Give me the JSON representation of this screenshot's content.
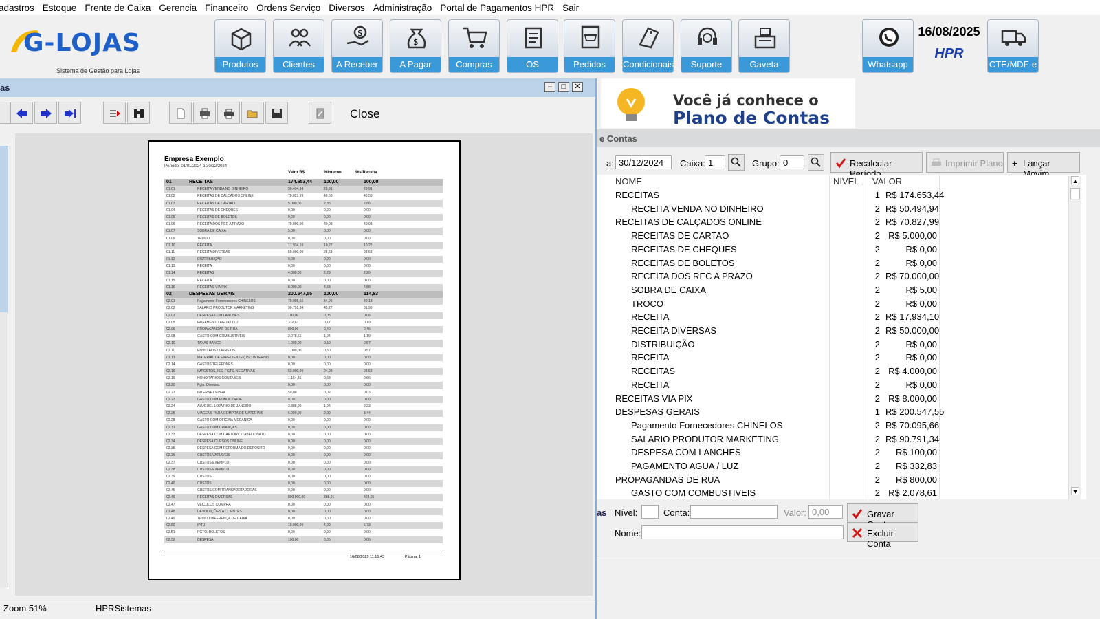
{
  "menu": [
    "adastros",
    "Estoque",
    "Frente de Caixa",
    "Gerencia",
    "Financeiro",
    "Ordens Serviço",
    "Diversos",
    "Administração",
    "Portal de Pagamentos HPR",
    "Sair"
  ],
  "logo": {
    "text": "G-LOJAS",
    "subtitle": "Sistema de Gestão para Lojas"
  },
  "toolbar": [
    {
      "label": "Produtos",
      "icon": "box-icon"
    },
    {
      "label": "Clientes",
      "icon": "people-icon"
    },
    {
      "label": "A Receber",
      "icon": "hand-money-icon"
    },
    {
      "label": "A Pagar",
      "icon": "money-bag-icon"
    },
    {
      "label": "Compras",
      "icon": "cart-icon"
    },
    {
      "label": "OS",
      "icon": "clipboard-icon"
    },
    {
      "label": "Pedidos",
      "icon": "order-cart-icon"
    },
    {
      "label": "Condicionais",
      "icon": "tag-icon"
    },
    {
      "label": "Suporte",
      "icon": "headset-icon"
    },
    {
      "label": "Gaveta",
      "icon": "cash-register-icon"
    },
    {
      "label": "Whatsapp",
      "icon": "whatsapp-icon"
    },
    {
      "label": "CTE/MDF-e",
      "icon": "truck-icon"
    }
  ],
  "date": "16/08/2025",
  "brand": "HPR",
  "report_window": {
    "title": "as",
    "close_label": "Close",
    "zoom": "Zoom 51%",
    "company": "HPRSistemas"
  },
  "report_page": {
    "company": "Empresa Exemplo",
    "period": "Período: 01/01/2024 à 30/12/2024",
    "headers": [
      "Valor R$",
      "%Interno",
      "%s/Receita"
    ],
    "rows": [
      {
        "c": "01",
        "n": "RECEITAS",
        "v": "174.653,44",
        "p": "100,00",
        "r": "100,00",
        "g": true
      },
      {
        "c": "01.01",
        "n": "RECEITA VENDA NO DINHEIRO",
        "v": "50.494,94",
        "p": "28,91",
        "r": "28,91"
      },
      {
        "c": "01.02",
        "n": "RECEITAS DE CALÇADOS ONLINE",
        "v": "70.827,99",
        "p": "40,55",
        "r": "40,55"
      },
      {
        "c": "01.03",
        "n": "RECEITAS DE CARTAO",
        "v": "5.000,00",
        "p": "2,86",
        "r": "2,86"
      },
      {
        "c": "01.04",
        "n": "RECEITAS DE CHEQUES",
        "v": "0,00",
        "p": "0,00",
        "r": "0,00"
      },
      {
        "c": "01.05",
        "n": "RECEITAS DE BOLETOS",
        "v": "0,00",
        "p": "0,00",
        "r": "0,00"
      },
      {
        "c": "01.06",
        "n": "RECEITA DOS REC A PRAZO",
        "v": "70.000,00",
        "p": "40,08",
        "r": "40,08"
      },
      {
        "c": "01.07",
        "n": "SOBRA DE CAIXA",
        "v": "5,00",
        "p": "0,00",
        "r": "0,00"
      },
      {
        "c": "01.09",
        "n": "TROCO",
        "v": "0,00",
        "p": "0,00",
        "r": "0,00"
      },
      {
        "c": "01.10",
        "n": "RECEITA",
        "v": "17.934,10",
        "p": "10,27",
        "r": "10,27"
      },
      {
        "c": "01.11",
        "n": "RECEITA DIVERSAS",
        "v": "50.000,00",
        "p": "28,63",
        "r": "28,63"
      },
      {
        "c": "01.12",
        "n": "DISTRIBUIÇÃO",
        "v": "0,00",
        "p": "0,00",
        "r": "0,00"
      },
      {
        "c": "01.13",
        "n": "RECEITA",
        "v": "0,00",
        "p": "0,00",
        "r": "0,00"
      },
      {
        "c": "01.14",
        "n": "RECEITAS",
        "v": "4.000,00",
        "p": "2,29",
        "r": "2,29"
      },
      {
        "c": "01.15",
        "n": "RECEITA",
        "v": "0,00",
        "p": "0,00",
        "r": "0,00"
      },
      {
        "c": "01.16",
        "n": "RECEITAS VIA PIX",
        "v": "8.000,00",
        "p": "4,58",
        "r": "4,58"
      },
      {
        "c": "02",
        "n": "DESPESAS GERAIS",
        "v": "200.547,55",
        "p": "100,00",
        "r": "114,83",
        "g": true
      },
      {
        "c": "02.01",
        "n": "Pagamento Fornecedores CHINELOS",
        "v": "70.095,66",
        "p": "34,95",
        "r": "40,13"
      },
      {
        "c": "02.02",
        "n": "SALARIO PRODUTOR MARKETING",
        "v": "90.791,34",
        "p": "45,27",
        "r": "51,98"
      },
      {
        "c": "02.03",
        "n": "DESPESA COM LANCHES",
        "v": "100,00",
        "p": "0,05",
        "r": "0,06"
      },
      {
        "c": "02.05",
        "n": "PAGAMENTO AGUA / LUZ",
        "v": "332,83",
        "p": "0,17",
        "r": "0,19"
      },
      {
        "c": "02.06",
        "n": "PROPAGANDAS DE RUA",
        "v": "800,00",
        "p": "0,40",
        "r": "0,46"
      },
      {
        "c": "02.08",
        "n": "GASTO COM COMBUSTIVEIS",
        "v": "2.078,61",
        "p": "1,04",
        "r": "1,19"
      },
      {
        "c": "02.10",
        "n": "TAXAS BANCO",
        "v": "1.000,00",
        "p": "0,50",
        "r": "0,57"
      },
      {
        "c": "02.11",
        "n": "ENVIO AOS CORREIOS",
        "v": "1.000,00",
        "p": "0,50",
        "r": "0,57"
      },
      {
        "c": "02.13",
        "n": "MATERIAL DE EXPEDIENTE (USO INTERNO)",
        "v": "0,00",
        "p": "0,00",
        "r": "0,00"
      },
      {
        "c": "02.14",
        "n": "GASTOS TELEFONES",
        "v": "0,00",
        "p": "0,00",
        "r": "0,00"
      },
      {
        "c": "02.16",
        "n": "IMPOSTOS, ISS, FGTS, NEGATIVAS",
        "v": "50.000,00",
        "p": "24,93",
        "r": "28,63"
      },
      {
        "c": "02.19",
        "n": "HONORARIOS CONTABEIS",
        "v": "1.154,81",
        "p": "0,58",
        "r": "0,66"
      },
      {
        "c": "02.20",
        "n": "Pgto. Diversos",
        "v": "0,00",
        "p": "0,00",
        "r": "0,00"
      },
      {
        "c": "02.21",
        "n": "INTERNET FIBRA",
        "v": "50,00",
        "p": "0,02",
        "r": "0,03"
      },
      {
        "c": "02.23",
        "n": "GASTO COM PUBLICIDADE",
        "v": "0,00",
        "p": "0,00",
        "r": "0,00"
      },
      {
        "c": "02.24",
        "n": "ALUGUEL LOJA RIO DE JANEIRO",
        "v": "3.888,00",
        "p": "1,94",
        "r": "2,23"
      },
      {
        "c": "02.25",
        "n": "VIAGENS PARA COMPRA DE MATERIAIS",
        "v": "6.000,00",
        "p": "2,99",
        "r": "3,44"
      },
      {
        "c": "02.28",
        "n": "GASTO COM OFICINA MECANICA",
        "v": "0,00",
        "p": "0,00",
        "r": "0,00"
      },
      {
        "c": "02.31",
        "n": "GASTO COM CRIANÇAS",
        "v": "0,00",
        "p": "0,00",
        "r": "0,00"
      },
      {
        "c": "02.33",
        "n": "DESPESA COM CARTORIO/TABELIONATO",
        "v": "0,00",
        "p": "0,00",
        "r": "0,00"
      },
      {
        "c": "02.34",
        "n": "DESPESA CURSOS ONLINE",
        "v": "0,00",
        "p": "0,00",
        "r": "0,00"
      },
      {
        "c": "02.35",
        "n": "DESPESA COM REFORMA DO DEPOSITO",
        "v": "0,00",
        "p": "0,00",
        "r": "0,00"
      },
      {
        "c": "02.36",
        "n": "CUSTOS VARIAVEIS",
        "v": "0,00",
        "p": "0,00",
        "r": "0,00"
      },
      {
        "c": "02.37",
        "n": "CUSTOS EXEMPLO",
        "v": "0,00",
        "p": "0,00",
        "r": "0,00"
      },
      {
        "c": "02.38",
        "n": "CUSTOS EXEMPLO",
        "v": "0,00",
        "p": "0,00",
        "r": "0,00"
      },
      {
        "c": "02.39",
        "n": "CUSTOS",
        "v": "0,00",
        "p": "0,00",
        "r": "0,00"
      },
      {
        "c": "02.40",
        "n": "CUSTOS",
        "v": "0,00",
        "p": "0,00",
        "r": "0,00"
      },
      {
        "c": "02.45",
        "n": "CUSTOS COM TRANSPORTADORAS",
        "v": "0,00",
        "p": "0,00",
        "r": "0,00"
      },
      {
        "c": "02.46",
        "n": "RECEITAS DIVERSAS",
        "v": "800.000,00",
        "p": "398,91",
        "r": "458,05"
      },
      {
        "c": "02.47",
        "n": "VEICULOS COMPRA",
        "v": "0,00",
        "p": "0,00",
        "r": "0,00"
      },
      {
        "c": "02.48",
        "n": "DEVOLUÇÕES A CLIENTES",
        "v": "0,00",
        "p": "0,00",
        "r": "0,00"
      },
      {
        "c": "02.49",
        "n": "TROCO/DIFERENÇA DE CAIXA",
        "v": "0,00",
        "p": "0,00",
        "r": "0,00"
      },
      {
        "c": "02.50",
        "n": "IPTU",
        "v": "10.000,00",
        "p": "4,99",
        "r": "5,73"
      },
      {
        "c": "02.51",
        "n": "PGTO. BOLETOS",
        "v": "0,00",
        "p": "0,00",
        "r": "0,00"
      },
      {
        "c": "02.52",
        "n": "DESPESA",
        "v": "100,00",
        "p": "0,05",
        "r": "0,06"
      }
    ],
    "footer_date": "16/08/2025 11:15:43",
    "footer_page": "Página:   1"
  },
  "banner": {
    "line1": "Você já conhece o",
    "line2": "Plano de Contas"
  },
  "accounts_panel": {
    "title": "e Contas",
    "to_label": "a:",
    "to_date": "30/12/2024",
    "caixa_label": "Caixa:",
    "caixa_value": "1",
    "grupo_label": "Grupo:",
    "grupo_value": "0",
    "btn_recalc": "Recalcular Período",
    "btn_print": "Imprimir Plano",
    "btn_launch": "Lançar Movim.",
    "col_name": "NOME",
    "col_level": "NIVEL",
    "col_value": "VALOR",
    "rows": [
      {
        "n": "RECEITAS",
        "lv": "1",
        "v": "R$ 174.653,44",
        "ind": 0
      },
      {
        "n": "RECEITA VENDA NO DINHEIRO",
        "lv": "2",
        "v": "R$ 50.494,94",
        "ind": 1
      },
      {
        "n": "RECEITAS DE CALÇADOS ONLINE",
        "lv": "2",
        "v": "R$ 70.827,99",
        "ind": 0
      },
      {
        "n": "RECEITAS DE CARTAO",
        "lv": "2",
        "v": "R$ 5.000,00",
        "ind": 1
      },
      {
        "n": "RECEITAS DE CHEQUES",
        "lv": "2",
        "v": "R$ 0,00",
        "ind": 1
      },
      {
        "n": "RECEITAS DE BOLETOS",
        "lv": "2",
        "v": "R$ 0,00",
        "ind": 1
      },
      {
        "n": "RECEITA DOS REC A PRAZO",
        "lv": "2",
        "v": "R$ 70.000,00",
        "ind": 1
      },
      {
        "n": "SOBRA DE CAIXA",
        "lv": "2",
        "v": "R$ 5,00",
        "ind": 1
      },
      {
        "n": "TROCO",
        "lv": "2",
        "v": "R$ 0,00",
        "ind": 1
      },
      {
        "n": "RECEITA",
        "lv": "2",
        "v": "R$ 17.934,10",
        "ind": 1
      },
      {
        "n": "RECEITA DIVERSAS",
        "lv": "2",
        "v": "R$ 50.000,00",
        "ind": 1
      },
      {
        "n": "DISTRIBUIÇÃO",
        "lv": "2",
        "v": "R$ 0,00",
        "ind": 1
      },
      {
        "n": "RECEITA",
        "lv": "2",
        "v": "R$ 0,00",
        "ind": 1
      },
      {
        "n": "RECEITAS",
        "lv": "2",
        "v": "R$ 4.000,00",
        "ind": 1
      },
      {
        "n": "RECEITA",
        "lv": "2",
        "v": "R$ 0,00",
        "ind": 1
      },
      {
        "n": "RECEITAS VIA PIX",
        "lv": "2",
        "v": "R$ 8.000,00",
        "ind": 0
      },
      {
        "n": "DESPESAS GERAIS",
        "lv": "1",
        "v": "R$ 200.547,55",
        "ind": 0
      },
      {
        "n": "Pagamento Fornecedores CHINELOS",
        "lv": "2",
        "v": "R$ 70.095,66",
        "ind": 1
      },
      {
        "n": "SALARIO PRODUTOR MARKETING",
        "lv": "2",
        "v": "R$ 90.791,34",
        "ind": 1
      },
      {
        "n": "DESPESA COM LANCHES",
        "lv": "2",
        "v": "R$ 100,00",
        "ind": 1
      },
      {
        "n": "PAGAMENTO AGUA / LUZ",
        "lv": "2",
        "v": "R$ 332,83",
        "ind": 1
      },
      {
        "n": "PROPAGANDAS DE RUA",
        "lv": "2",
        "v": "R$ 800,00",
        "ind": 0
      },
      {
        "n": "GASTO COM COMBUSTIVEIS",
        "lv": "2",
        "v": "R$ 2.078,61",
        "ind": 1
      }
    ],
    "edit": {
      "tab_label": "as",
      "nivel_label": "Nível:",
      "conta_label": "Conta:",
      "valor_label": "Valor:",
      "valor_value": "0,00",
      "nome_label": "Nome:",
      "btn_save": "Gravar Conta",
      "btn_delete": "Excluir Conta"
    }
  },
  "colors": {
    "accent": "#3a9ad9",
    "brand": "#1e60c8",
    "title_bar": "#bcd4ea"
  }
}
